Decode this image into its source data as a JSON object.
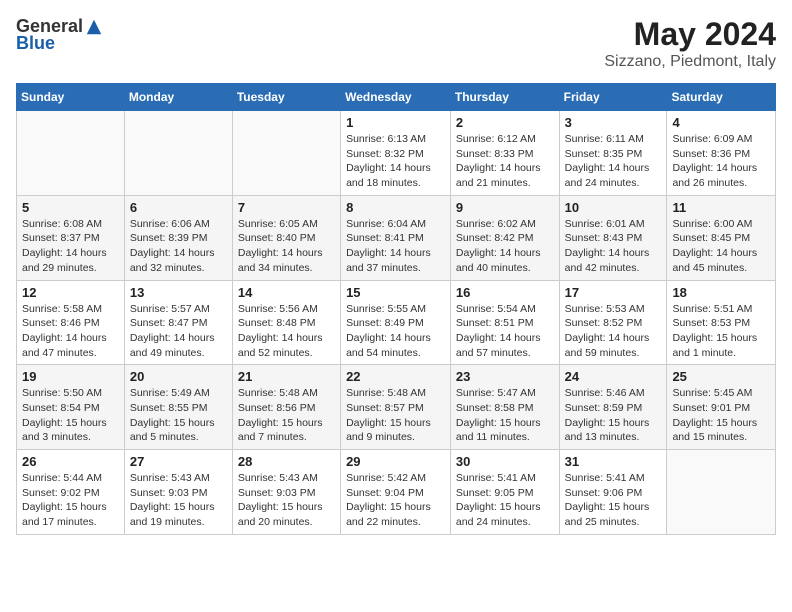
{
  "header": {
    "logo_general": "General",
    "logo_blue": "Blue",
    "title": "May 2024",
    "location": "Sizzano, Piedmont, Italy"
  },
  "days_of_week": [
    "Sunday",
    "Monday",
    "Tuesday",
    "Wednesday",
    "Thursday",
    "Friday",
    "Saturday"
  ],
  "weeks": [
    [
      {
        "day": "",
        "info": ""
      },
      {
        "day": "",
        "info": ""
      },
      {
        "day": "",
        "info": ""
      },
      {
        "day": "1",
        "info": "Sunrise: 6:13 AM\nSunset: 8:32 PM\nDaylight: 14 hours and 18 minutes."
      },
      {
        "day": "2",
        "info": "Sunrise: 6:12 AM\nSunset: 8:33 PM\nDaylight: 14 hours and 21 minutes."
      },
      {
        "day": "3",
        "info": "Sunrise: 6:11 AM\nSunset: 8:35 PM\nDaylight: 14 hours and 24 minutes."
      },
      {
        "day": "4",
        "info": "Sunrise: 6:09 AM\nSunset: 8:36 PM\nDaylight: 14 hours and 26 minutes."
      }
    ],
    [
      {
        "day": "5",
        "info": "Sunrise: 6:08 AM\nSunset: 8:37 PM\nDaylight: 14 hours and 29 minutes."
      },
      {
        "day": "6",
        "info": "Sunrise: 6:06 AM\nSunset: 8:39 PM\nDaylight: 14 hours and 32 minutes."
      },
      {
        "day": "7",
        "info": "Sunrise: 6:05 AM\nSunset: 8:40 PM\nDaylight: 14 hours and 34 minutes."
      },
      {
        "day": "8",
        "info": "Sunrise: 6:04 AM\nSunset: 8:41 PM\nDaylight: 14 hours and 37 minutes."
      },
      {
        "day": "9",
        "info": "Sunrise: 6:02 AM\nSunset: 8:42 PM\nDaylight: 14 hours and 40 minutes."
      },
      {
        "day": "10",
        "info": "Sunrise: 6:01 AM\nSunset: 8:43 PM\nDaylight: 14 hours and 42 minutes."
      },
      {
        "day": "11",
        "info": "Sunrise: 6:00 AM\nSunset: 8:45 PM\nDaylight: 14 hours and 45 minutes."
      }
    ],
    [
      {
        "day": "12",
        "info": "Sunrise: 5:58 AM\nSunset: 8:46 PM\nDaylight: 14 hours and 47 minutes."
      },
      {
        "day": "13",
        "info": "Sunrise: 5:57 AM\nSunset: 8:47 PM\nDaylight: 14 hours and 49 minutes."
      },
      {
        "day": "14",
        "info": "Sunrise: 5:56 AM\nSunset: 8:48 PM\nDaylight: 14 hours and 52 minutes."
      },
      {
        "day": "15",
        "info": "Sunrise: 5:55 AM\nSunset: 8:49 PM\nDaylight: 14 hours and 54 minutes."
      },
      {
        "day": "16",
        "info": "Sunrise: 5:54 AM\nSunset: 8:51 PM\nDaylight: 14 hours and 57 minutes."
      },
      {
        "day": "17",
        "info": "Sunrise: 5:53 AM\nSunset: 8:52 PM\nDaylight: 14 hours and 59 minutes."
      },
      {
        "day": "18",
        "info": "Sunrise: 5:51 AM\nSunset: 8:53 PM\nDaylight: 15 hours and 1 minute."
      }
    ],
    [
      {
        "day": "19",
        "info": "Sunrise: 5:50 AM\nSunset: 8:54 PM\nDaylight: 15 hours and 3 minutes."
      },
      {
        "day": "20",
        "info": "Sunrise: 5:49 AM\nSunset: 8:55 PM\nDaylight: 15 hours and 5 minutes."
      },
      {
        "day": "21",
        "info": "Sunrise: 5:48 AM\nSunset: 8:56 PM\nDaylight: 15 hours and 7 minutes."
      },
      {
        "day": "22",
        "info": "Sunrise: 5:48 AM\nSunset: 8:57 PM\nDaylight: 15 hours and 9 minutes."
      },
      {
        "day": "23",
        "info": "Sunrise: 5:47 AM\nSunset: 8:58 PM\nDaylight: 15 hours and 11 minutes."
      },
      {
        "day": "24",
        "info": "Sunrise: 5:46 AM\nSunset: 8:59 PM\nDaylight: 15 hours and 13 minutes."
      },
      {
        "day": "25",
        "info": "Sunrise: 5:45 AM\nSunset: 9:01 PM\nDaylight: 15 hours and 15 minutes."
      }
    ],
    [
      {
        "day": "26",
        "info": "Sunrise: 5:44 AM\nSunset: 9:02 PM\nDaylight: 15 hours and 17 minutes."
      },
      {
        "day": "27",
        "info": "Sunrise: 5:43 AM\nSunset: 9:03 PM\nDaylight: 15 hours and 19 minutes."
      },
      {
        "day": "28",
        "info": "Sunrise: 5:43 AM\nSunset: 9:03 PM\nDaylight: 15 hours and 20 minutes."
      },
      {
        "day": "29",
        "info": "Sunrise: 5:42 AM\nSunset: 9:04 PM\nDaylight: 15 hours and 22 minutes."
      },
      {
        "day": "30",
        "info": "Sunrise: 5:41 AM\nSunset: 9:05 PM\nDaylight: 15 hours and 24 minutes."
      },
      {
        "day": "31",
        "info": "Sunrise: 5:41 AM\nSunset: 9:06 PM\nDaylight: 15 hours and 25 minutes."
      },
      {
        "day": "",
        "info": ""
      }
    ]
  ]
}
